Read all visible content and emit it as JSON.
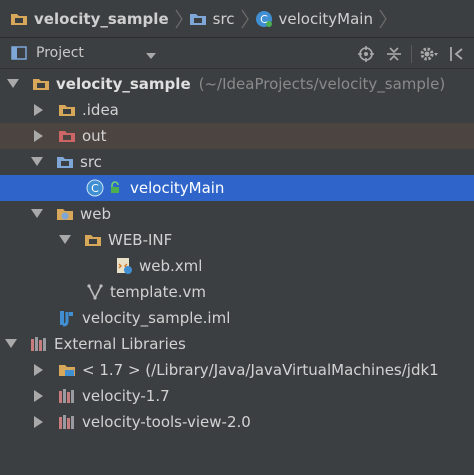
{
  "breadcrumb": {
    "items": [
      {
        "label": "velocity_sample",
        "icon": "folder-icon"
      },
      {
        "label": "src",
        "icon": "source-folder-icon"
      },
      {
        "label": "velocityMain",
        "icon": "class-icon"
      }
    ]
  },
  "toolbar": {
    "view_label": "Project"
  },
  "tree": {
    "root": {
      "label": "velocity_sample",
      "hint": "(~/IdeaProjects/velocity_sample)"
    },
    "idea": {
      "label": ".idea"
    },
    "out": {
      "label": "out"
    },
    "src": {
      "label": "src"
    },
    "velocity_main": {
      "label": "velocityMain"
    },
    "web": {
      "label": "web"
    },
    "web_inf": {
      "label": "WEB-INF"
    },
    "web_xml": {
      "label": "web.xml"
    },
    "template_vm": {
      "label": "template.vm"
    },
    "iml": {
      "label": "velocity_sample.iml"
    },
    "external_libraries": {
      "label": "External Libraries"
    },
    "jdk": {
      "label": "< 1.7 > (/Library/Java/JavaVirtualMachines/jdk1"
    },
    "velocity": {
      "label": "velocity-1.7"
    },
    "velocity_tools": {
      "label": "velocity-tools-view-2.0"
    }
  },
  "colors": {
    "background": "#3c3f41",
    "selection": "#2f65ca",
    "excluded_row": "#4b4440",
    "folder": "#d7a75a",
    "excluded_folder": "#cc6666",
    "source_folder": "#7ea7d8"
  }
}
